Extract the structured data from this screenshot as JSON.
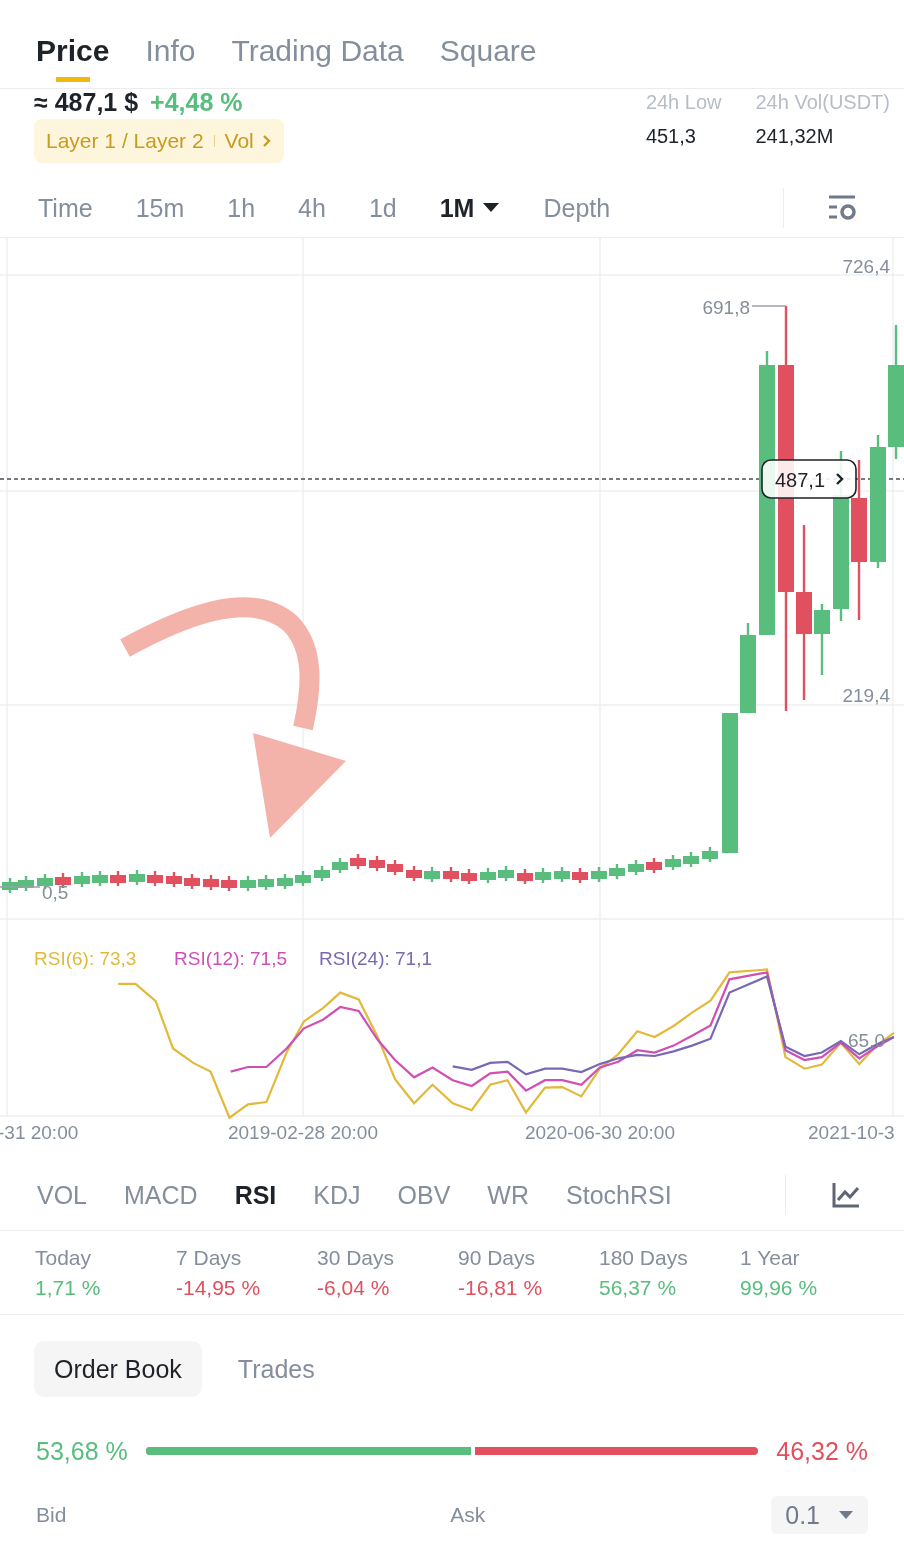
{
  "tabs": [
    {
      "label": "Price",
      "selected": true
    },
    {
      "label": "Info",
      "selected": false
    },
    {
      "label": "Trading Data",
      "selected": false
    },
    {
      "label": "Square",
      "selected": false
    }
  ],
  "price": {
    "value": "≈ 487,1 $",
    "change": "+4,48 %",
    "tag": "Layer 1 / Layer 2",
    "tag_link": "Vol"
  },
  "stats": [
    {
      "label": "24h Low",
      "value": "451,3"
    },
    {
      "label": "24h Vol(USDT)",
      "value": "241,32M"
    }
  ],
  "intervals": [
    {
      "label": "Time",
      "selected": false,
      "kind": "plain"
    },
    {
      "label": "15m",
      "selected": false,
      "kind": "plain"
    },
    {
      "label": "1h",
      "selected": false,
      "kind": "plain"
    },
    {
      "label": "4h",
      "selected": false,
      "kind": "plain"
    },
    {
      "label": "1d",
      "selected": false,
      "kind": "plain"
    },
    {
      "label": "1M",
      "selected": true,
      "kind": "dropdown"
    },
    {
      "label": "Depth",
      "selected": false,
      "kind": "plain"
    }
  ],
  "chart": {
    "y_labels": [
      "726,4",
      "219,4"
    ],
    "high_label": "691,8",
    "low_label": "0,5",
    "last_price": "487,1",
    "rsi_legend": [
      {
        "label": "RSI(6): 73,3",
        "color": "#e2b93b"
      },
      {
        "label": "RSI(12): 71,5",
        "color": "#cf4fb4"
      },
      {
        "label": "RSI(24): 71,1",
        "color": "#7a68b4"
      }
    ],
    "rsi_label": "65,0",
    "x_labels": [
      "-31 20:00",
      "2019-02-28 20:00",
      "2020-06-30 20:00",
      "2021-10-3"
    ]
  },
  "indicators": [
    {
      "label": "VOL",
      "selected": false
    },
    {
      "label": "MACD",
      "selected": false
    },
    {
      "label": "RSI",
      "selected": true
    },
    {
      "label": "KDJ",
      "selected": false
    },
    {
      "label": "OBV",
      "selected": false
    },
    {
      "label": "WR",
      "selected": false
    },
    {
      "label": "StochRSI",
      "selected": false
    }
  ],
  "performance": [
    {
      "label": "Today",
      "value": "1,71 %",
      "color": "#58bd7d"
    },
    {
      "label": "7 Days",
      "value": "-14,95 %",
      "color": "#e0505e"
    },
    {
      "label": "30 Days",
      "value": "-6,04 %",
      "color": "#e0505e"
    },
    {
      "label": "90 Days",
      "value": "-16,81 %",
      "color": "#e0505e"
    },
    {
      "label": "180 Days",
      "value": "56,37 %",
      "color": "#58bd7d"
    },
    {
      "label": "1 Year",
      "value": "99,96 %",
      "color": "#58bd7d"
    }
  ],
  "order_tabs": [
    {
      "label": "Order Book",
      "selected": true
    },
    {
      "label": "Trades",
      "selected": false
    }
  ],
  "depth": {
    "bid_percent": "53,68 %",
    "ask_percent": "46,32 %",
    "level": 0.5368,
    "bid_label": "Bid",
    "ask_label": "Ask",
    "precision": "0.1"
  }
}
